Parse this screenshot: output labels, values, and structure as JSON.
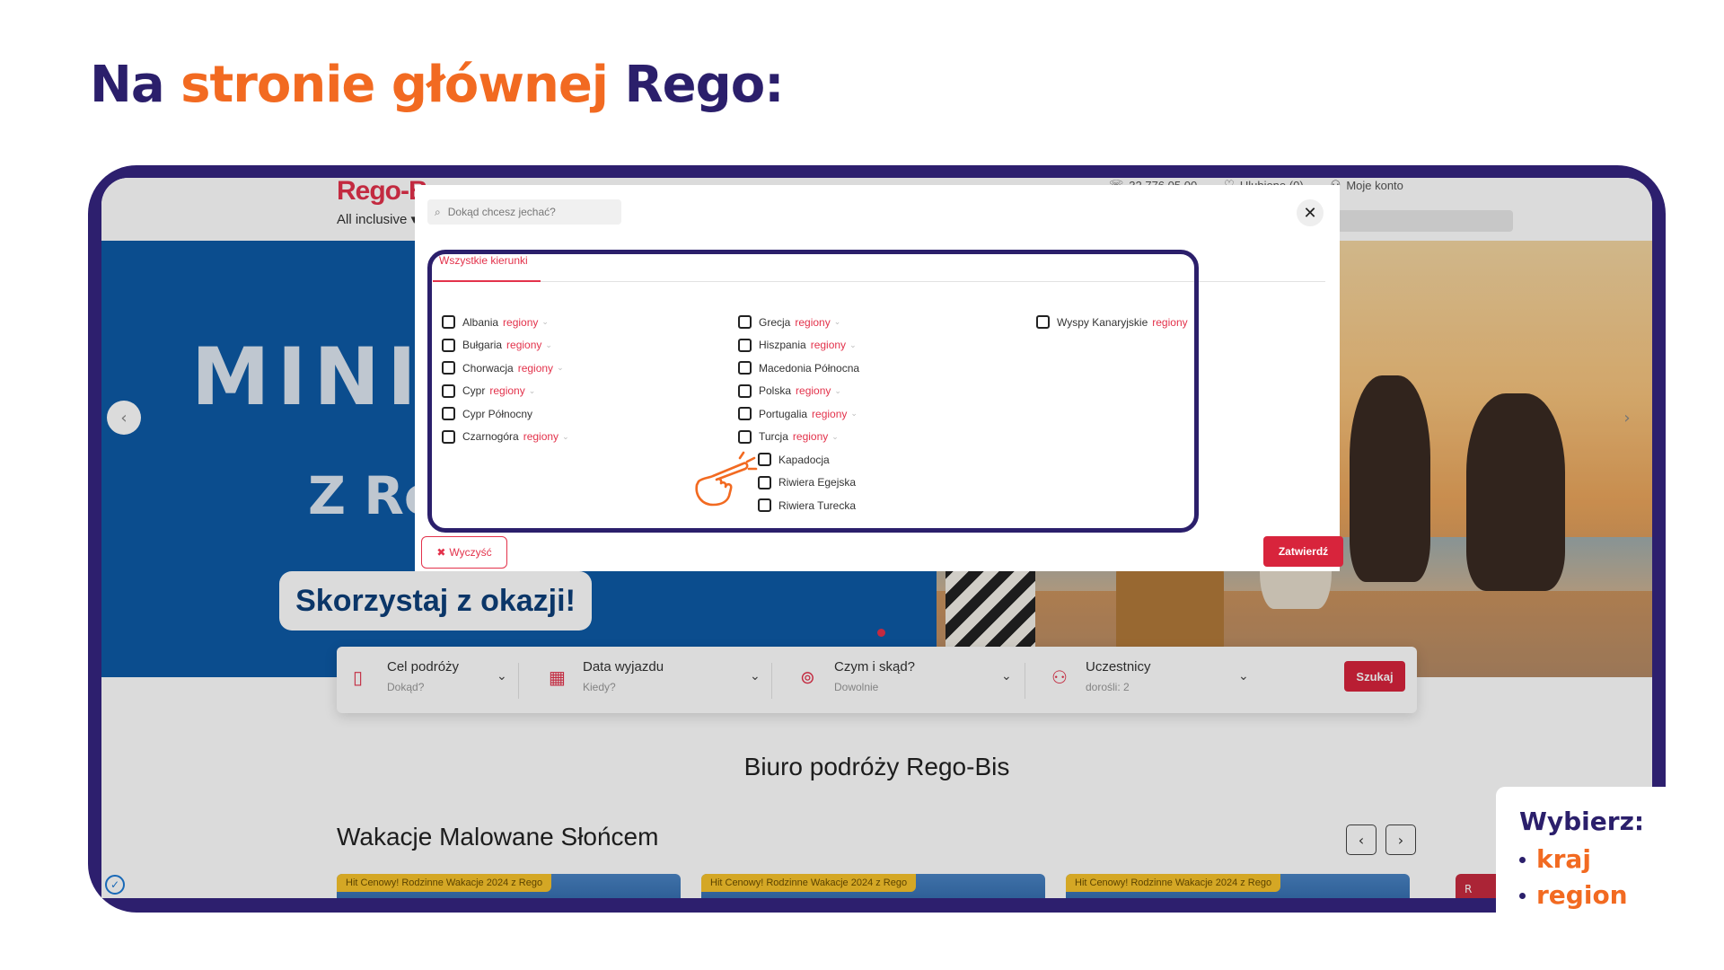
{
  "slide": {
    "title_prefix": "Na ",
    "title_highlight": "stronie głównej",
    "title_suffix": " Rego:"
  },
  "site": {
    "logo": "Rego-B",
    "nav_all_inclusive": "All inclusive",
    "phone": "32 776 05 00",
    "favorites": "Ulubione (0)",
    "account": "Moje konto",
    "hero_text_1": "MINI C",
    "hero_text_2": "Z Reg",
    "hero_button": "Skorzystaj z okazji!",
    "search_bar": {
      "fields": [
        {
          "label": "Cel podróży",
          "sub": "Dokąd?"
        },
        {
          "label": "Data wyjazdu",
          "sub": "Kiedy?"
        },
        {
          "label": "Czym i skąd?",
          "sub": "Dowolnie"
        },
        {
          "label": "Uczestnicy",
          "sub": "dorośli: 2"
        }
      ],
      "button": "Szukaj"
    },
    "section_title": "Biuro podróży Rego-Bis",
    "carousel_title": "Wakacje Malowane Słońcem",
    "card_badge": "Hit Cenowy! Rodzinne Wakacje 2024 z Rego",
    "card_red_text": "R"
  },
  "modal": {
    "search_placeholder": "Dokąd chcesz jechać?",
    "tab_label": "Wszystkie kierunki",
    "regions_label": "regiony",
    "columns": [
      [
        {
          "name": "Albania",
          "regions": true
        },
        {
          "name": "Bułgaria",
          "regions": true
        },
        {
          "name": "Chorwacja",
          "regions": true
        },
        {
          "name": "Cypr",
          "regions": true
        },
        {
          "name": "Cypr Północny",
          "regions": false
        },
        {
          "name": "Czarnogóra",
          "regions": true
        }
      ],
      [
        {
          "name": "Grecja",
          "regions": true
        },
        {
          "name": "Hiszpania",
          "regions": true
        },
        {
          "name": "Macedonia Północna",
          "regions": false
        },
        {
          "name": "Polska",
          "regions": true
        },
        {
          "name": "Portugalia",
          "regions": true
        },
        {
          "name": "Turcja",
          "regions": true
        }
      ],
      [
        {
          "name": "Wyspy Kanaryjskie",
          "regions": true
        }
      ]
    ],
    "turkey_subregions": [
      "Kapadocja",
      "Riwiera Egejska",
      "Riwiera Turecka"
    ],
    "clear_button": "Wyczyść",
    "confirm_button": "Zatwierdź"
  },
  "callout": {
    "title": "Wybierz:",
    "items": [
      "kraj",
      "region"
    ]
  },
  "colors": {
    "brand_navy": "#2b1f6b",
    "brand_orange": "#f26a21",
    "rego_red": "#d8243c"
  }
}
